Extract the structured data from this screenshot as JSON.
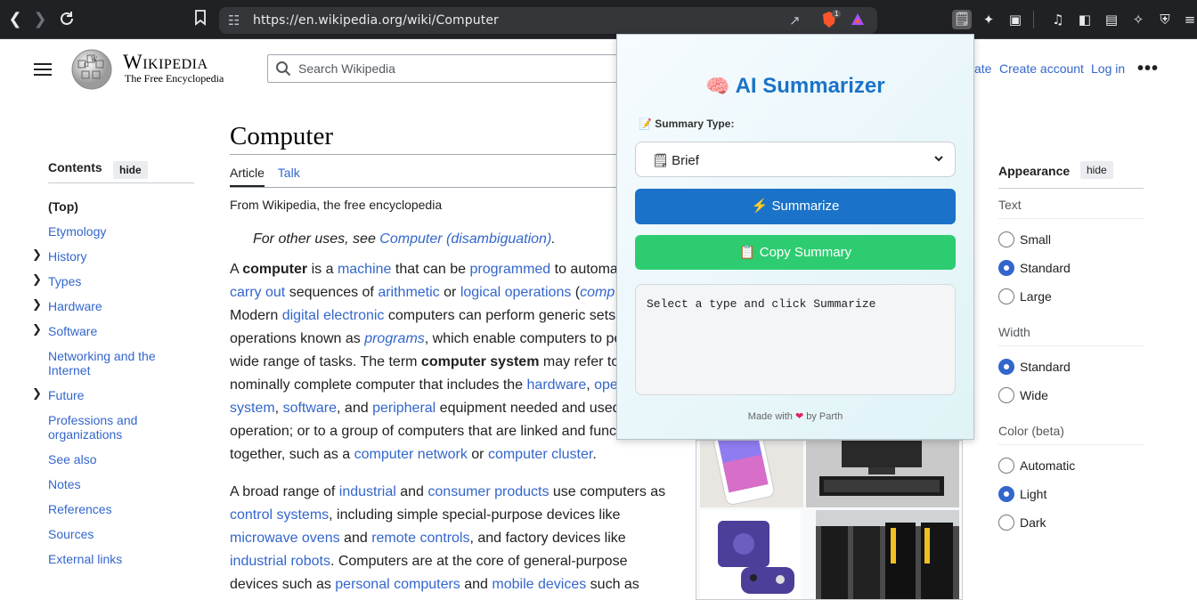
{
  "browser": {
    "url": "https://en.wikipedia.org/wiki/Computer",
    "brave_badge": "1"
  },
  "wiki": {
    "wordmark": "Wikipedia",
    "tagline": "The Free Encyclopedia",
    "search_placeholder": "Search Wikipedia",
    "header_links": [
      "ate",
      "Create account",
      "Log in"
    ],
    "more": "•••"
  },
  "toc": {
    "title": "Contents",
    "hide": "hide",
    "items": [
      {
        "label": "(Top)",
        "bold": true,
        "chevron": false
      },
      {
        "label": "Etymology",
        "chevron": false
      },
      {
        "label": "History",
        "chevron": true
      },
      {
        "label": "Types",
        "chevron": true
      },
      {
        "label": "Hardware",
        "chevron": true
      },
      {
        "label": "Software",
        "chevron": true
      },
      {
        "label": "Networking and the Internet",
        "chevron": false
      },
      {
        "label": "Future",
        "chevron": true
      },
      {
        "label": "Professions and organizations",
        "chevron": false
      },
      {
        "label": "See also",
        "chevron": false
      },
      {
        "label": "Notes",
        "chevron": false
      },
      {
        "label": "References",
        "chevron": false
      },
      {
        "label": "Sources",
        "chevron": false
      },
      {
        "label": "External links",
        "chevron": false
      }
    ]
  },
  "article": {
    "title": "Computer",
    "tabs": [
      "Article",
      "Talk"
    ],
    "from": "From Wikipedia, the free encyclopedia",
    "hatnote_prefix": "For other uses, see ",
    "hatnote_link": "Computer (disambiguation)",
    "hatnote_suffix": ".",
    "para1": [
      [
        [
          "t",
          "A "
        ],
        [
          "b",
          "computer"
        ],
        [
          "t",
          " is a "
        ],
        [
          "a",
          "machine"
        ],
        [
          "t",
          " that can be "
        ],
        [
          "a",
          "programmed"
        ],
        [
          "t",
          " to automa"
        ]
      ],
      [
        [
          "a",
          "carry out"
        ],
        [
          "t",
          " sequences of "
        ],
        [
          "a",
          "arithmetic"
        ],
        [
          "t",
          " or "
        ],
        [
          "a",
          "logical operations"
        ],
        [
          "t",
          " ("
        ],
        [
          "ai",
          "comp"
        ]
      ],
      [
        [
          "t",
          "Modern "
        ],
        [
          "a",
          "digital electronic"
        ],
        [
          "t",
          " computers can perform generic sets"
        ]
      ],
      [
        [
          "t",
          "operations known as "
        ],
        [
          "ai",
          "programs"
        ],
        [
          "t",
          ", which enable computers to pe"
        ]
      ],
      [
        [
          "t",
          "wide range of tasks. The term "
        ],
        [
          "b",
          "computer system"
        ],
        [
          "t",
          " may refer to"
        ]
      ],
      [
        [
          "t",
          "nominally complete computer that includes the "
        ],
        [
          "a",
          "hardware"
        ],
        [
          "t",
          ", "
        ],
        [
          "a",
          "ope"
        ]
      ],
      [
        [
          "a",
          "system"
        ],
        [
          "t",
          ", "
        ],
        [
          "a",
          "software"
        ],
        [
          "t",
          ", and "
        ],
        [
          "a",
          "peripheral"
        ],
        [
          "t",
          " equipment needed and used"
        ]
      ],
      [
        [
          "t",
          "operation; or to a group of computers that are linked and func"
        ]
      ],
      [
        [
          "t",
          "together, such as a "
        ],
        [
          "a",
          "computer network"
        ],
        [
          "t",
          " or "
        ],
        [
          "a",
          "computer cluster"
        ],
        [
          "t",
          "."
        ]
      ]
    ],
    "para2": [
      [
        [
          "t",
          "A broad range of "
        ],
        [
          "a",
          "industrial"
        ],
        [
          "t",
          " and "
        ],
        [
          "a",
          "consumer products"
        ],
        [
          "t",
          " use computers as"
        ]
      ],
      [
        [
          "a",
          "control systems"
        ],
        [
          "t",
          ", including simple special-purpose devices like"
        ]
      ],
      [
        [
          "a",
          "microwave ovens"
        ],
        [
          "t",
          " and "
        ],
        [
          "a",
          "remote controls"
        ],
        [
          "t",
          ", and factory devices like"
        ]
      ],
      [
        [
          "a",
          "industrial robots"
        ],
        [
          "t",
          ". Computers are at the core of general-purpose"
        ]
      ],
      [
        [
          "t",
          "devices such as "
        ],
        [
          "a",
          "personal computers"
        ],
        [
          "t",
          " and "
        ],
        [
          "a",
          "mobile devices"
        ],
        [
          "t",
          " such as"
        ]
      ]
    ]
  },
  "appearance": {
    "title": "Appearance",
    "hide": "hide",
    "groups": [
      {
        "label": "Text",
        "options": [
          "Small",
          "Standard",
          "Large"
        ],
        "selected": "Standard"
      },
      {
        "label": "Width",
        "options": [
          "Standard",
          "Wide"
        ],
        "selected": "Standard"
      },
      {
        "label": "Color (beta)",
        "options": [
          "Automatic",
          "Light",
          "Dark"
        ],
        "selected": "Light"
      }
    ]
  },
  "popup": {
    "title": "AI Summarizer",
    "title_emoji": "🧠",
    "summary_type_label": "Summary Type:",
    "selected_type": "Brief",
    "summarize_label": "Summarize",
    "copy_label": "Copy Summary",
    "output_text": "Select a type and click Summarize",
    "footer_prefix": "Made with",
    "footer_suffix": "by Parth"
  },
  "colors": {
    "link": "#3366cc",
    "summarize": "#1a73c8",
    "copy": "#2ecc71",
    "chrome": "#202124"
  }
}
